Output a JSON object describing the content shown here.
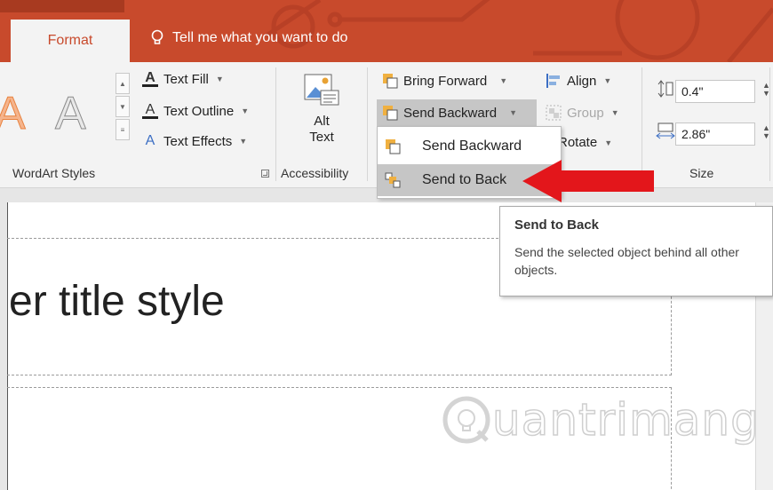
{
  "ribbon_tabs": {
    "active": "Format",
    "tell_me": "Tell me what you want to do"
  },
  "wordart": {
    "text_fill": "Text Fill",
    "text_outline": "Text Outline",
    "text_effects": "Text Effects",
    "group_label": "WordArt Styles"
  },
  "accessibility": {
    "alt_line1": "Alt",
    "alt_line2": "Text",
    "group_label": "Accessibility"
  },
  "arrange": {
    "bring_forward": "Bring Forward",
    "send_backward": "Send Backward",
    "align": "Align",
    "group": "Group",
    "rotate": "Rotate"
  },
  "size": {
    "height": "0.4\"",
    "width": "2.86\"",
    "group_label": "Size"
  },
  "dropdown": {
    "items": [
      {
        "label": "Send Backward",
        "highlighted": false
      },
      {
        "label": "Send to Back",
        "highlighted": true
      }
    ]
  },
  "tooltip": {
    "title": "Send to Back",
    "description": "Send the selected object behind all other objects."
  },
  "slide": {
    "title_text": "er title style"
  },
  "watermark": {
    "text": "uantrimang"
  },
  "colors": {
    "titlebar": "#c84a2c",
    "arrow": "#e3161b",
    "highlight": "#c6c6c6"
  },
  "icons": [
    "help-bulb-icon",
    "text-fill-icon",
    "text-outline-icon",
    "text-effects-icon",
    "alt-text-icon",
    "bring-forward-icon",
    "send-backward-icon",
    "align-icon",
    "group-icon",
    "rotate-icon",
    "shape-height-icon",
    "shape-width-icon",
    "dialog-launcher-icon",
    "red-arrow-icon"
  ]
}
